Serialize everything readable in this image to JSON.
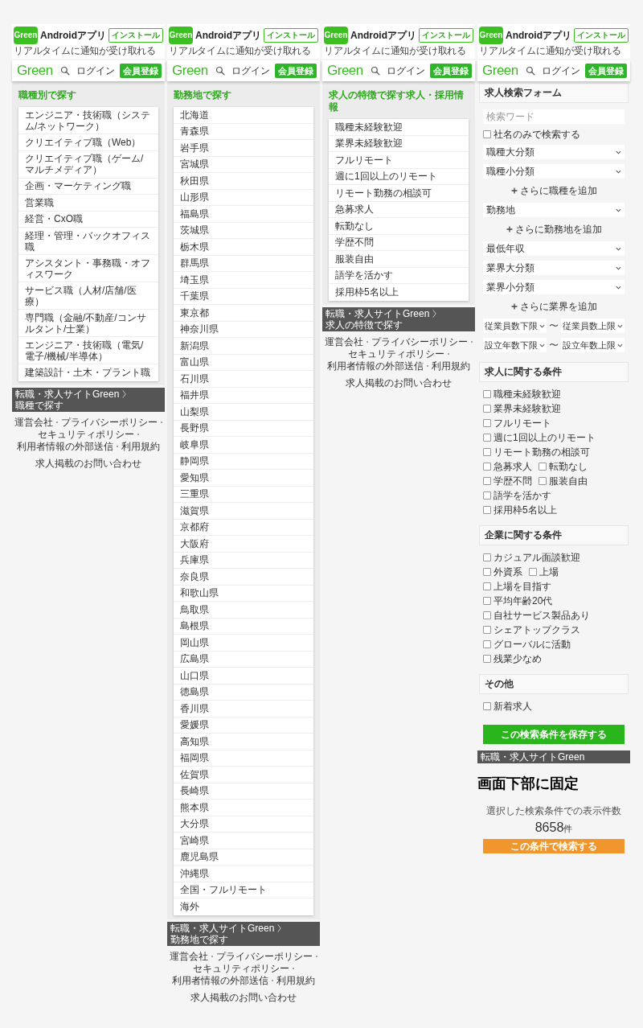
{
  "screens": [
    {
      "kind": "list",
      "app_banner": {
        "icon_label": "Green",
        "title": "Androidアプリ",
        "subtitle": "リアルタイムに通知が受け取れる",
        "button": "インストール"
      },
      "header": {
        "logo": "Green",
        "login": "ログイン",
        "signup": "会員登録"
      },
      "heading": "職種別で探す",
      "items": [
        "エンジニア・技術職（システム/ネットワーク）",
        "クリエイティブ職（Web）",
        "クリエイティブ職（ゲーム/マルチメディア）",
        "企画・マーケティング職",
        "営業職",
        "経営・CxO職",
        "経理・管理・バックオフィス職",
        "アシスタント・事務職・オフィスワーク",
        "サービス職（人材/店舗/医療）",
        "専門職（金融/不動産/コンサルタント/士業）",
        "エンジニア・技術職（電気/電子/機械/半導体）",
        "建築設計・土木・プラント職"
      ],
      "breadcrumb": [
        "転職・求人サイトGreen",
        "職種で探す"
      ],
      "footer_links": [
        [
          "運営会社",
          "プライバシーポリシー",
          "セキュリティポリシー",
          "利用者情報の外部送信",
          "利用規約"
        ],
        [
          "求人掲載のお問い合わせ"
        ]
      ]
    },
    {
      "kind": "list",
      "app_banner": {
        "icon_label": "Green",
        "title": "Androidアプリ",
        "subtitle": "リアルタイムに通知が受け取れる",
        "button": "インストール"
      },
      "header": {
        "logo": "Green",
        "login": "ログイン",
        "signup": "会員登録"
      },
      "heading": "勤務地で探す",
      "items": [
        "北海道",
        "青森県",
        "岩手県",
        "宮城県",
        "秋田県",
        "山形県",
        "福島県",
        "茨城県",
        "栃木県",
        "群馬県",
        "埼玉県",
        "千葉県",
        "東京都",
        "神奈川県",
        "新潟県",
        "富山県",
        "石川県",
        "福井県",
        "山梨県",
        "長野県",
        "岐阜県",
        "静岡県",
        "愛知県",
        "三重県",
        "滋賀県",
        "京都府",
        "大阪府",
        "兵庫県",
        "奈良県",
        "和歌山県",
        "鳥取県",
        "島根県",
        "岡山県",
        "広島県",
        "山口県",
        "徳島県",
        "香川県",
        "愛媛県",
        "高知県",
        "福岡県",
        "佐賀県",
        "長崎県",
        "熊本県",
        "大分県",
        "宮崎県",
        "鹿児島県",
        "沖縄県",
        "全国・フルリモート",
        "海外"
      ],
      "breadcrumb": [
        "転職・求人サイトGreen",
        "勤務地で探す"
      ],
      "footer_links": [
        [
          "運営会社",
          "プライバシーポリシー",
          "セキュリティポリシー",
          "利用者情報の外部送信",
          "利用規約"
        ],
        [
          "求人掲載のお問い合わせ"
        ]
      ]
    },
    {
      "kind": "list",
      "app_banner": {
        "icon_label": "Green",
        "title": "Androidアプリ",
        "subtitle": "リアルタイムに通知が受け取れる",
        "button": "インストール"
      },
      "header": {
        "logo": "Green",
        "login": "ログイン",
        "signup": "会員登録"
      },
      "heading": "求人の特徴で探す求人・採用情報",
      "items": [
        "職種未経験歓迎",
        "業界未経験歓迎",
        "フルリモート",
        "週に1回以上のリモート",
        "リモート勤務の相談可",
        "急募求人",
        "転勤なし",
        "学歴不問",
        "服装自由",
        "語学を活かす",
        "採用枠5名以上"
      ],
      "breadcrumb": [
        "転職・求人サイトGreen",
        "求人の特徴で探す"
      ],
      "footer_links": [
        [
          "運営会社",
          "プライバシーポリシー",
          "セキュリティポリシー",
          "利用者情報の外部送信",
          "利用規約"
        ],
        [
          "求人掲載のお問い合わせ"
        ]
      ]
    },
    {
      "kind": "form",
      "app_banner": {
        "icon_label": "Green",
        "title": "Androidアプリ",
        "subtitle": "リアルタイムに通知が受け取れる",
        "button": "インストール"
      },
      "header": {
        "logo": "Green",
        "login": "ログイン",
        "signup": "会員登録"
      },
      "form": {
        "title": "求人検索フォーム",
        "fields": [
          {
            "kind": "text",
            "placeholder": "検索ワード"
          },
          {
            "kind": "checkbox",
            "label": "社名のみで検索する",
            "checked": false
          },
          {
            "kind": "select",
            "label": "職種大分類"
          },
          {
            "kind": "select",
            "label": "職種小分類"
          },
          {
            "kind": "add",
            "label": "さらに職種を追加"
          },
          {
            "kind": "select",
            "label": "勤務地"
          },
          {
            "kind": "add",
            "label": "さらに勤務地を追加"
          },
          {
            "kind": "select",
            "label": "最低年収"
          },
          {
            "kind": "select",
            "label": "業界大分類"
          },
          {
            "kind": "select",
            "label": "業界小分類"
          },
          {
            "kind": "add",
            "label": "さらに業界を追加"
          },
          {
            "kind": "range",
            "from": "従業員数下限",
            "separator": "〜",
            "to": "従業員数上限"
          },
          {
            "kind": "range",
            "from": "設立年数下限",
            "separator": "〜",
            "to": "設立年数上限"
          }
        ],
        "sections": [
          {
            "title": "求人に関する条件",
            "options": [
              {
                "label": "職種未経験歓迎",
                "checked": false
              },
              {
                "label": "業界未経験歓迎",
                "checked": false
              },
              {
                "label": "フルリモート",
                "checked": false
              },
              {
                "label": "週に1回以上のリモート",
                "checked": false
              },
              {
                "label": "リモート勤務の相談可",
                "checked": false
              },
              {
                "label": "急募求人",
                "checked": false
              },
              {
                "label": "転勤なし",
                "checked": false
              },
              {
                "label": "学歴不問",
                "checked": false
              },
              {
                "label": "服装自由",
                "checked": false
              },
              {
                "label": "語学を活かす",
                "checked": false
              },
              {
                "label": "採用枠5名以上",
                "checked": false
              }
            ]
          },
          {
            "title": "企業に関する条件",
            "options": [
              {
                "label": "カジュアル面談歓迎",
                "checked": false
              },
              {
                "label": "外資系",
                "checked": false
              },
              {
                "label": "上場",
                "checked": false
              },
              {
                "label": "上場を目指す",
                "checked": false
              },
              {
                "label": "平均年齢20代",
                "checked": false
              },
              {
                "label": "自社サービス製品あり",
                "checked": false
              },
              {
                "label": "シェアトップクラス",
                "checked": false
              },
              {
                "label": "グローバルに活動",
                "checked": false
              },
              {
                "label": "残業少なめ",
                "checked": false
              }
            ]
          },
          {
            "title": "その他",
            "options": [
              {
                "label": "新着求人",
                "checked": false
              }
            ]
          }
        ],
        "save_button": "この検索条件を保存する"
      },
      "breadcrumb": [
        "転職・求人サイトGreen"
      ],
      "note": "画面下部に固定",
      "results": {
        "caption": "選択した検索条件での表示件数",
        "count": "8658",
        "unit": "件",
        "button": "この条件で検索する"
      }
    }
  ]
}
